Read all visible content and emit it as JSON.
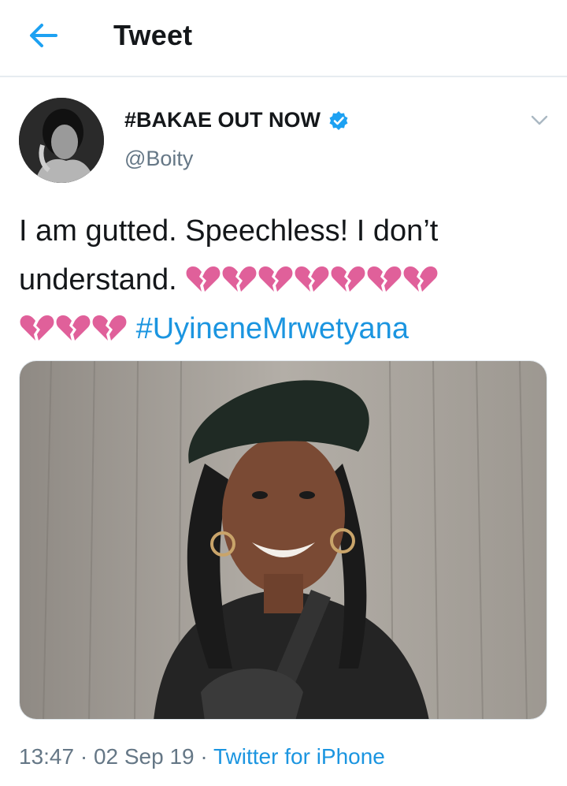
{
  "header": {
    "title": "Tweet",
    "back_icon": "arrow-left-icon"
  },
  "tweet": {
    "display_name": "#BAKAE OUT NOW",
    "handle": "@Boity",
    "verified": true,
    "text_line1": "I am gutted. Speechless! I don’t",
    "text_line2": "understand.",
    "hashtag": "#UyineneMrwetyana",
    "broken_heart_count_line2": 7,
    "broken_heart_count_line3": 3,
    "timestamp": "13:47 · 02 Sep 19 · ",
    "source": "Twitter for iPhone"
  },
  "colors": {
    "link": "#1b95e0",
    "secondary_text": "#657786",
    "heart": "#e0609a"
  }
}
